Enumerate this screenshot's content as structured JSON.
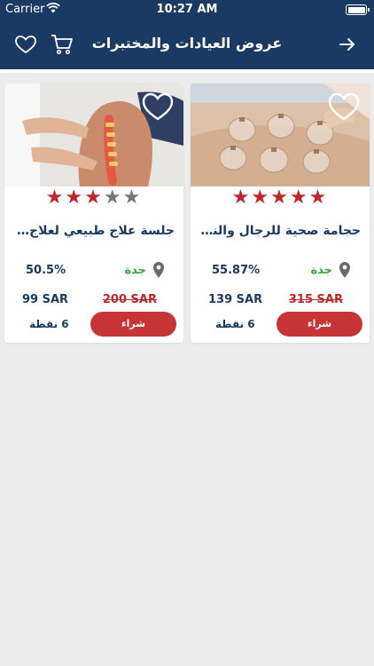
{
  "status_bar": {
    "carrier": "Carrier",
    "time": "10:27 AM"
  },
  "header": {
    "title": "عروض العيادات والمختبرات"
  },
  "offers": [
    {
      "title": "حجامة صحية للرجال والنساء",
      "rating": 5,
      "rating_max": 5,
      "city": "جدة",
      "discount": "55.87%",
      "old_price": "315 SAR",
      "new_price": "139 SAR",
      "buy_label": "شراء",
      "points": "6 نقطة"
    },
    {
      "title": "جلسة علاج طبيعي لعلاج الا...",
      "rating": 3,
      "rating_max": 5,
      "city": "جدة",
      "discount": "50.5%",
      "old_price": "200 SAR",
      "new_price": "99 SAR",
      "buy_label": "شراء",
      "points": "6 نقطة"
    }
  ],
  "colors": {
    "header_bg": "#1b3a63",
    "accent_red": "#c63437",
    "city_green": "#3aa53a",
    "text_navy": "#1b3a63"
  },
  "icons": {
    "nav_left": [
      "heart-icon",
      "cart-icon"
    ],
    "nav_right": "arrow-right-icon",
    "card_favorite": "heart-outline-icon",
    "location": "location-pin-icon",
    "rating": "star-icon"
  }
}
